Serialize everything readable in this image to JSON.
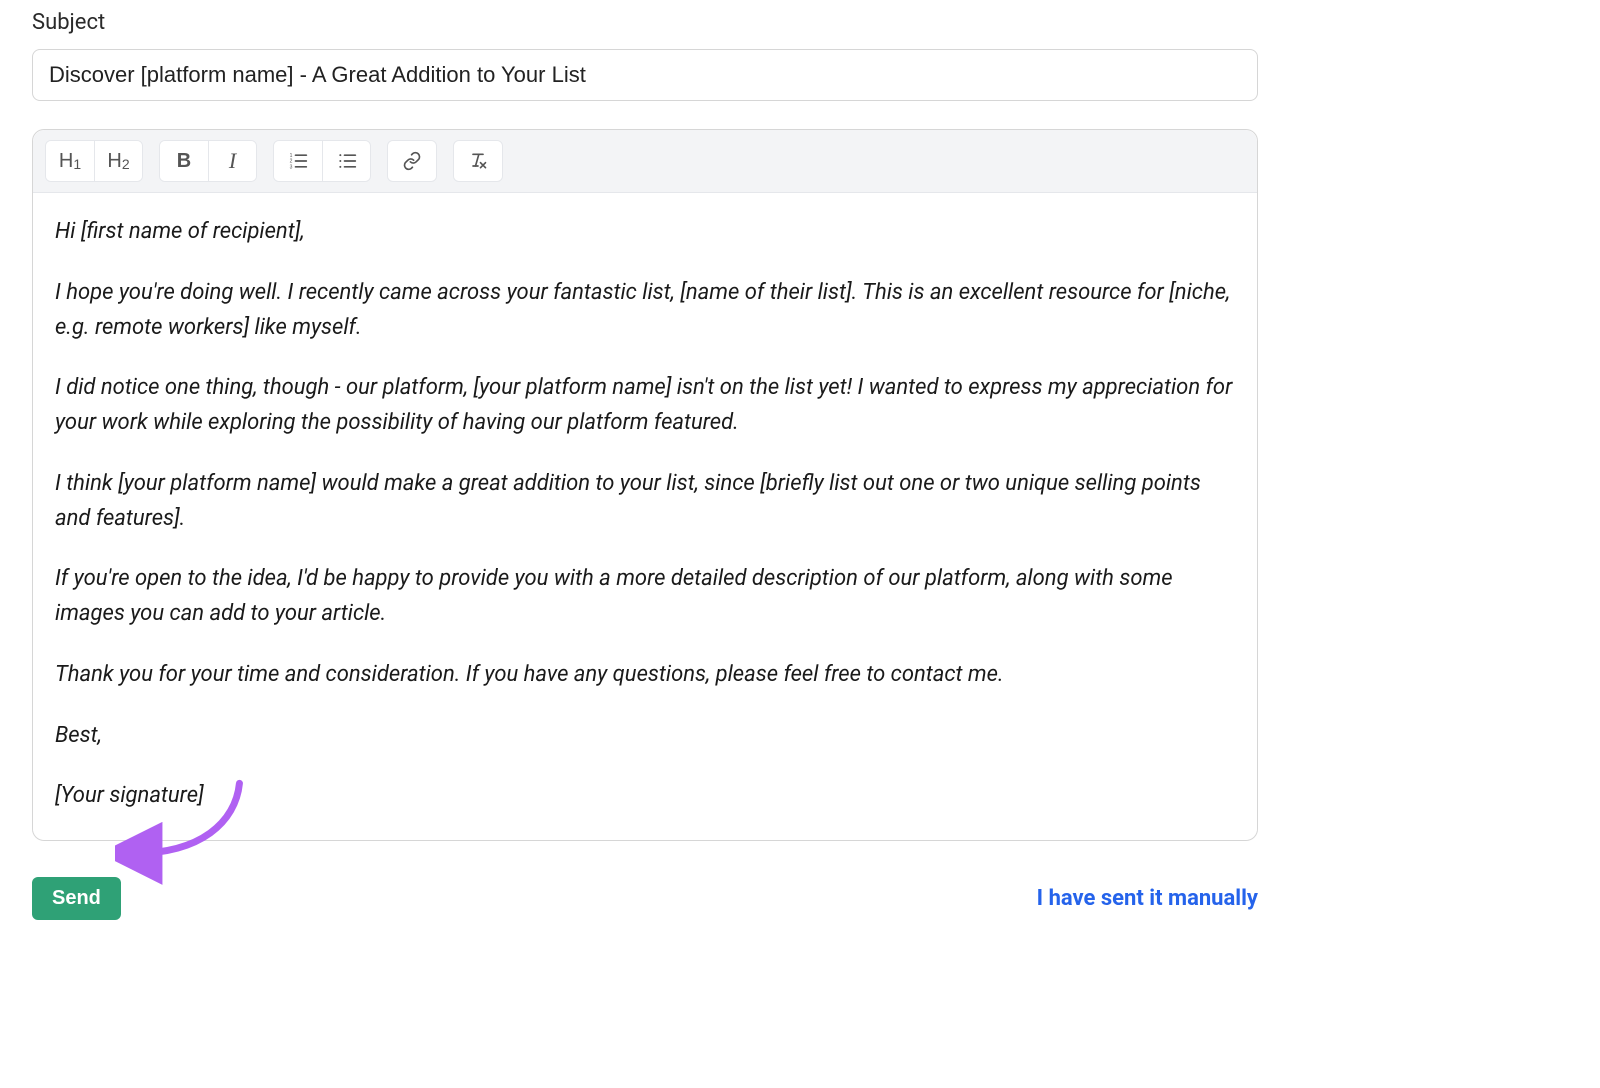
{
  "subject": {
    "label": "Subject",
    "value": "Discover [platform name] - A Great Addition to Your List"
  },
  "toolbar": {
    "h1": "H1",
    "h2": "H2",
    "bold": "B",
    "italic": "I",
    "ordered_list_icon": "ordered-list",
    "unordered_list_icon": "unordered-list",
    "link_icon": "link",
    "clear_format_icon": "clear-format"
  },
  "body": {
    "p1": "Hi [first name of recipient],",
    "p2": "I hope you're doing well. I recently came across your fantastic list, [name of their list]. This is an excellent resource for [niche, e.g. remote workers] like myself.",
    "p3": "I did notice one thing, though - our platform, [your platform name] isn't on the list yet! I wanted to express my appreciation for your work while exploring the possibility of having our platform featured.",
    "p4": "I think [your platform name] would make a great addition to your list, since [briefly list out one or two unique selling points and features].",
    "p5": "If you're open to the idea, I'd be happy to provide you with a more detailed description of our platform, along with some images you can add to your article.",
    "p6": "Thank you for your time and consideration. If you have any questions, please feel free to contact me.",
    "p7": "Best,",
    "p8": "[Your signature]"
  },
  "actions": {
    "send_label": "Send",
    "manual_link_label": "I have sent it manually"
  },
  "colors": {
    "send_bg": "#2fa176",
    "link": "#2563eb",
    "annotation": "#b061f2"
  }
}
